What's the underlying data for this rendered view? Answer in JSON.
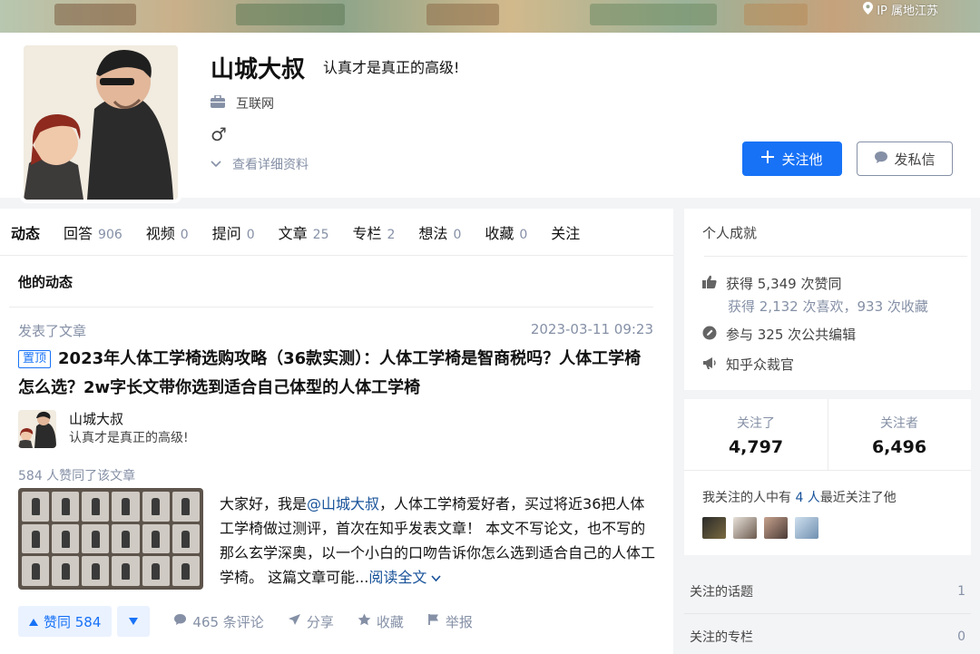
{
  "cover": {
    "ip_location": "IP 属地江苏"
  },
  "profile": {
    "name": "山城大叔",
    "headline": "认真才是真正的高级!",
    "industry": "互联网",
    "gender_symbol": "♂",
    "more_link": "查看详细资料",
    "follow_label": "关注他",
    "message_label": "发私信"
  },
  "tabs": [
    {
      "label": "动态",
      "count": ""
    },
    {
      "label": "回答",
      "count": "906"
    },
    {
      "label": "视频",
      "count": "0"
    },
    {
      "label": "提问",
      "count": "0"
    },
    {
      "label": "文章",
      "count": "25"
    },
    {
      "label": "专栏",
      "count": "2"
    },
    {
      "label": "想法",
      "count": "0"
    },
    {
      "label": "收藏",
      "count": "0"
    },
    {
      "label": "关注",
      "count": ""
    }
  ],
  "feed": {
    "section_title": "他的动态",
    "action": "发表了文章",
    "time": "2023-03-11 09:23",
    "pin_tag": "置顶",
    "title": "2023年人体工学椅选购攻略（36款实测）：人体工学椅是智商税吗？人体工学椅怎么选？2w字长文带你选到适合自己体型的人体工学椅",
    "author_name": "山城大叔",
    "author_headline": "认真才是真正的高级!",
    "likes_line": "584 人赞同了该文章",
    "excerpt_before": "大家好，我是",
    "excerpt_mention": "@山城大叔",
    "excerpt_after": "，人体工学椅爱好者，买过将近36把人体工学椅做过测评，首次在知乎发表文章！ 本文不写论文，也不写的那么玄学深奥，以一个小白的口吻告诉你怎么选到适合自己的人体工学椅。 这篇文章可能...",
    "read_more": "阅读全文",
    "vote_label": "赞同 584",
    "comments": "465 条评论",
    "share": "分享",
    "favorite": "收藏",
    "report": "举报"
  },
  "achievements": {
    "title": "个人成就",
    "likes": "获得 5,349 次赞同",
    "likes_sub": "获得 2,132 次喜欢，933 次收藏",
    "edits": "参与 325 次公共编辑",
    "juror": "知乎众裁官"
  },
  "stats": {
    "following_label": "关注了",
    "following": "4,797",
    "followers_label": "关注者",
    "followers": "6,496",
    "mutual_before": "我关注的人中有 ",
    "mutual_count": "4 人",
    "mutual_after": "最近关注了他"
  },
  "side_links": [
    {
      "label": "关注的话题",
      "count": "1"
    },
    {
      "label": "关注的专栏",
      "count": "0"
    }
  ],
  "colors": {
    "accent": "#1772f6",
    "link": "#175199",
    "muted": "#8590a6"
  }
}
